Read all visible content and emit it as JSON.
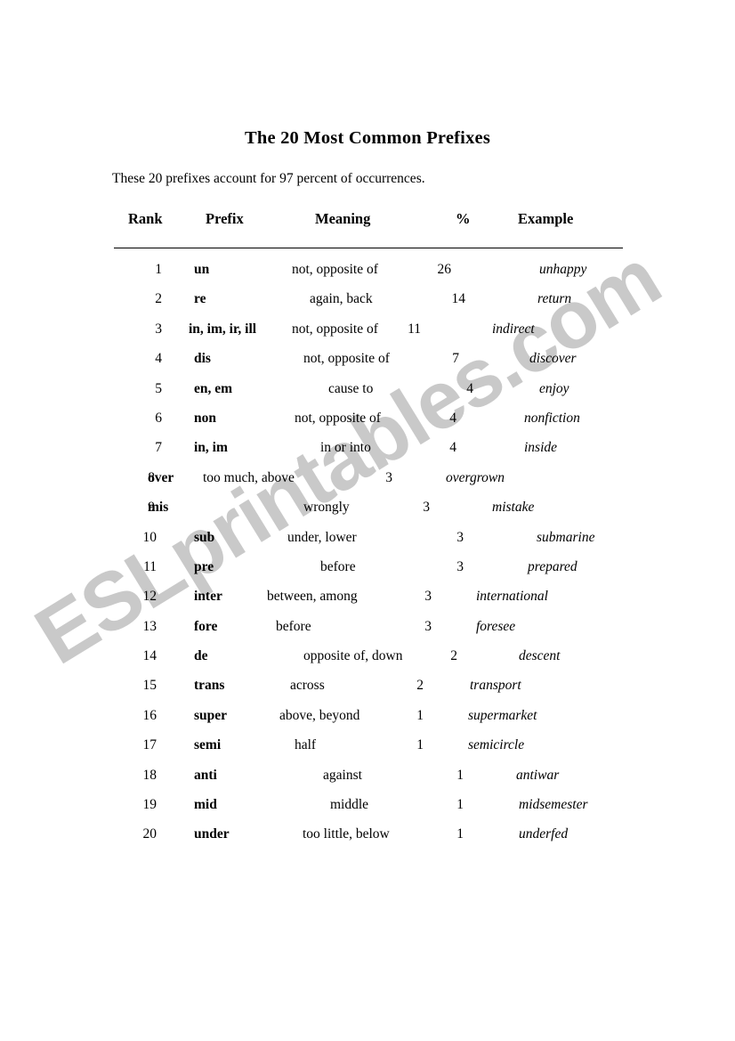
{
  "document": {
    "title": "The 20 Most Common Prefixes",
    "intro": "These 20 prefixes account for 97 percent of occurrences."
  },
  "watermark": {
    "text": "ESLprintables.com",
    "color": "#c9c9c9"
  },
  "table": {
    "headers": {
      "rank": "Rank",
      "prefix": "Prefix",
      "meaning": "Meaning",
      "percent": "%",
      "example": "Example"
    },
    "rows": [
      {
        "rank": "1",
        "prefix": "un",
        "meaning": "not, opposite of",
        "percent": "26",
        "example": "unhappy",
        "x": {
          "rank": 20,
          "prefix": 90,
          "meaning": 200,
          "percent": 361,
          "example": 478
        }
      },
      {
        "rank": "2",
        "prefix": "re",
        "meaning": "again, back",
        "percent": "14",
        "example": "return",
        "x": {
          "rank": 20,
          "prefix": 90,
          "meaning": 220,
          "percent": 377,
          "example": 476
        }
      },
      {
        "rank": "3",
        "prefix": "in, im, ir, ill",
        "meaning": "not, opposite of",
        "percent": "11",
        "example": "indirect",
        "x": {
          "rank": 20,
          "prefix": 84,
          "meaning": 200,
          "percent": 327,
          "example": 425
        }
      },
      {
        "rank": "4",
        "prefix": "dis",
        "meaning": "not, opposite of",
        "percent": "7",
        "example": "discover",
        "x": {
          "rank": 20,
          "prefix": 90,
          "meaning": 213,
          "percent": 370,
          "example": 467
        }
      },
      {
        "rank": "5",
        "prefix": "en, em",
        "meaning": "cause to",
        "percent": "4",
        "example": "enjoy",
        "x": {
          "rank": 20,
          "prefix": 90,
          "meaning": 241,
          "percent": 386,
          "example": 478
        }
      },
      {
        "rank": "6",
        "prefix": "non",
        "meaning": "not, opposite of",
        "percent": "4",
        "example": "nonfiction",
        "x": {
          "rank": 20,
          "prefix": 90,
          "meaning": 203,
          "percent": 367,
          "example": 461
        }
      },
      {
        "rank": "7",
        "prefix": "in, im",
        "meaning": "in or into",
        "percent": "4",
        "example": "inside",
        "x": {
          "rank": 20,
          "prefix": 90,
          "meaning": 232,
          "percent": 367,
          "example": 461
        }
      },
      {
        "rank": "8",
        "prefix": "over",
        "meaning": "too much, above",
        "percent": "3",
        "example": "overgrown",
        "x": {
          "rank": 12,
          "prefix": 38,
          "meaning": 100,
          "percent": 295,
          "example": 373
        }
      },
      {
        "rank": "9",
        "prefix": "mis",
        "meaning": "wrongly",
        "percent": "3",
        "example": "mistake",
        "x": {
          "rank": 12,
          "prefix": 38,
          "meaning": 213,
          "percent": 337,
          "example": 425
        }
      },
      {
        "rank": "10",
        "prefix": "sub",
        "meaning": "under, lower",
        "percent": "3",
        "example": "submarine",
        "x": {
          "rank": 14,
          "prefix": 90,
          "meaning": 195,
          "percent": 375,
          "example": 475
        }
      },
      {
        "rank": "11",
        "prefix": "pre",
        "meaning": "before",
        "percent": "3",
        "example": "prepared",
        "x": {
          "rank": 14,
          "prefix": 90,
          "meaning": 232,
          "percent": 375,
          "example": 465
        }
      },
      {
        "rank": "12",
        "prefix": "inter",
        "meaning": "between, among",
        "percent": "3",
        "example": "international",
        "x": {
          "rank": 14,
          "prefix": 90,
          "meaning": 172,
          "percent": 339,
          "example": 407
        }
      },
      {
        "rank": "13",
        "prefix": "fore",
        "meaning": "before",
        "percent": "3",
        "example": "foresee",
        "x": {
          "rank": 14,
          "prefix": 90,
          "meaning": 182,
          "percent": 339,
          "example": 407
        }
      },
      {
        "rank": "14",
        "prefix": "de",
        "meaning": "opposite of, down",
        "percent": "2",
        "example": "descent",
        "x": {
          "rank": 14,
          "prefix": 90,
          "meaning": 213,
          "percent": 368,
          "example": 455
        }
      },
      {
        "rank": "15",
        "prefix": "trans",
        "meaning": "across",
        "percent": "2",
        "example": "transport",
        "x": {
          "rank": 14,
          "prefix": 90,
          "meaning": 198,
          "percent": 330,
          "example": 400
        }
      },
      {
        "rank": "16",
        "prefix": "super",
        "meaning": "above, beyond",
        "percent": "1",
        "example": "supermarket",
        "x": {
          "rank": 14,
          "prefix": 90,
          "meaning": 186,
          "percent": 330,
          "example": 398
        }
      },
      {
        "rank": "17",
        "prefix": "semi",
        "meaning": "half",
        "percent": "1",
        "example": "semicircle",
        "x": {
          "rank": 14,
          "prefix": 90,
          "meaning": 203,
          "percent": 330,
          "example": 398
        }
      },
      {
        "rank": "18",
        "prefix": "anti",
        "meaning": "against",
        "percent": "1",
        "example": "antiwar",
        "x": {
          "rank": 14,
          "prefix": 90,
          "meaning": 235,
          "percent": 375,
          "example": 452
        }
      },
      {
        "rank": "19",
        "prefix": "mid",
        "meaning": "middle",
        "percent": "1",
        "example": "midsemester",
        "x": {
          "rank": 14,
          "prefix": 90,
          "meaning": 243,
          "percent": 375,
          "example": 455
        }
      },
      {
        "rank": "20",
        "prefix": "under",
        "meaning": "too little, below",
        "percent": "1",
        "example": "underfed",
        "x": {
          "rank": 14,
          "prefix": 90,
          "meaning": 212,
          "percent": 375,
          "example": 455
        }
      }
    ]
  }
}
